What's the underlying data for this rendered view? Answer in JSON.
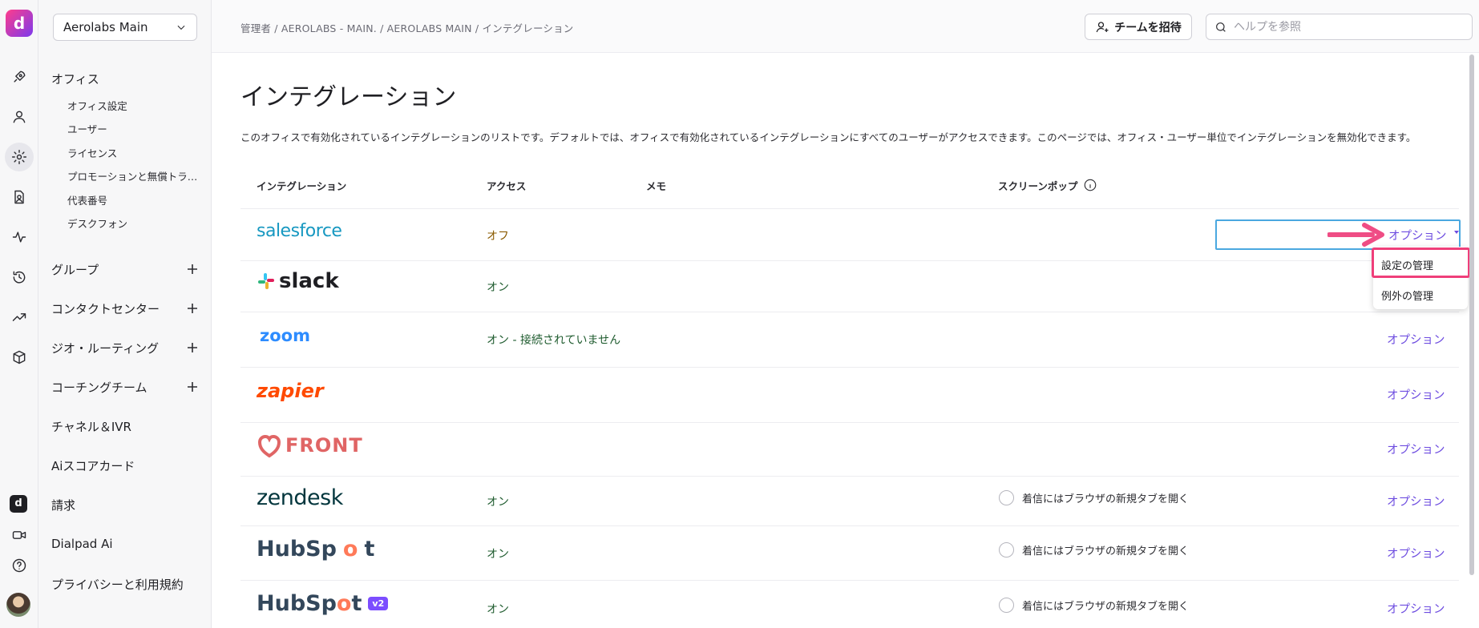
{
  "app": {
    "logo": "d"
  },
  "rail": {
    "icons": [
      "rocket-icon",
      "user-icon",
      "gear-icon",
      "contacts-icon",
      "activity-icon",
      "history-icon",
      "trend-icon",
      "cube-icon",
      "dialpad-icon",
      "video-icon",
      "help-icon",
      "avatar"
    ]
  },
  "sidebar": {
    "org": "Aerolabs Main",
    "office_head": "オフィス",
    "office_items": [
      "オフィス設定",
      "ユーザー",
      "ライセンス",
      "プロモーションと無償トライアル",
      "代表番号",
      "デスクフォン"
    ],
    "groups": "グループ",
    "contact_center": "コンタクトセンター",
    "geo_routing": "ジオ・ルーティング",
    "coaching": "コーチングチーム",
    "channels": "チャネル＆IVR",
    "scorecard": "Aiスコアカード",
    "billing": "請求",
    "dialpad_ai": "Dialpad Ai",
    "privacy": "プライバシーと利用規約"
  },
  "header": {
    "breadcrumb": "管理者 / AEROLABS - MAIN. / AEROLABS MAIN / インテグレーション",
    "invite_label": "チームを招待",
    "search_placeholder": "ヘルプを参照"
  },
  "main": {
    "title": "インテグレーション",
    "description": "このオフィスで有効化されているインテグレーションのリストです。デフォルトでは、オフィスで有効化されているインテグレーションにすべてのユーザーがアクセスできます。このページでは、オフィス・ユーザー単位でインテグレーションを無効化できます。",
    "columns": {
      "integration": "インテグレーション",
      "access": "アクセス",
      "memo": "メモ",
      "screenpop": "スクリーンポップ"
    },
    "option_label": "オプション",
    "screenpop_text": "着信にはブラウザの新規タブを開く",
    "rows": [
      {
        "name": "salesforce",
        "access": "オフ"
      },
      {
        "name": "slack",
        "access": "オン"
      },
      {
        "name": "zoom",
        "access": "オン - 接続されていません"
      },
      {
        "name": "zapier",
        "access": ""
      },
      {
        "name": "FRONT",
        "access": ""
      },
      {
        "name": "zendesk",
        "access": "オン"
      },
      {
        "name": "HubSpot",
        "access": "オン"
      },
      {
        "name": "HubSpot",
        "access": "オン",
        "badge": "v2"
      }
    ],
    "dropdown": {
      "items": [
        "設定の管理",
        "例外の管理"
      ]
    }
  },
  "colors": {
    "accent": "#6d4ce0",
    "highlight": "#ef3f7a",
    "on": "#1e5b2e",
    "off": "#8a5a00"
  }
}
